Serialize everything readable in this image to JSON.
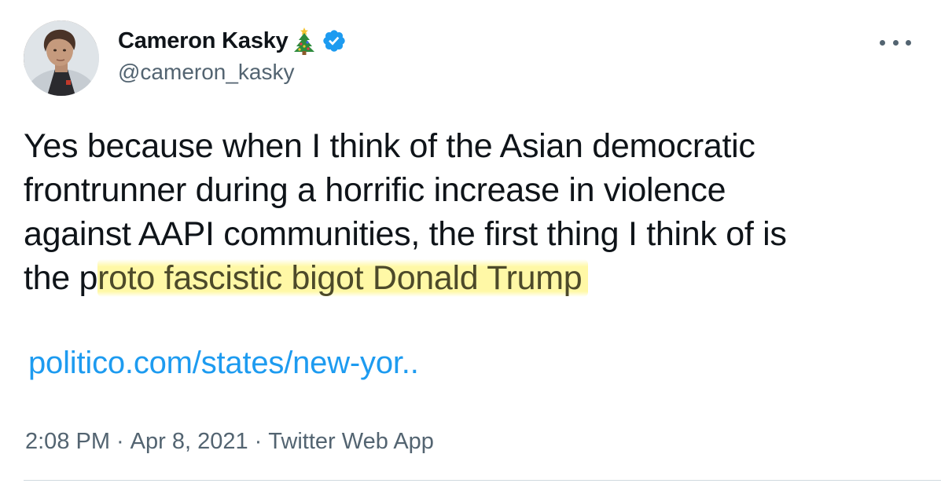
{
  "user": {
    "display_name": "Cameron Kasky",
    "handle": "@cameron_kasky",
    "name_emoji": "christmas-tree-icon",
    "verified": true,
    "verified_color": "#1d9bf0"
  },
  "tweet": {
    "lines": [
      "Yes because when I think of the Asian democratic",
      "frontrunner during a horrific increase in violence",
      "against AAPI communities, the first thing I think of is"
    ],
    "last_line_prefix": "the p",
    "last_line_highlight": "roto fascistic bigot Donald Trump",
    "highlight_color": "#fff796",
    "link_text": "politico.com/states/new-yor..",
    "link_color": "#1d9bf0"
  },
  "meta": {
    "time": "2:08 PM",
    "separator": "·",
    "date": "Apr 8, 2021",
    "source": "Twitter Web App"
  },
  "actions": {
    "more_icon": "more-horizontal-icon"
  }
}
